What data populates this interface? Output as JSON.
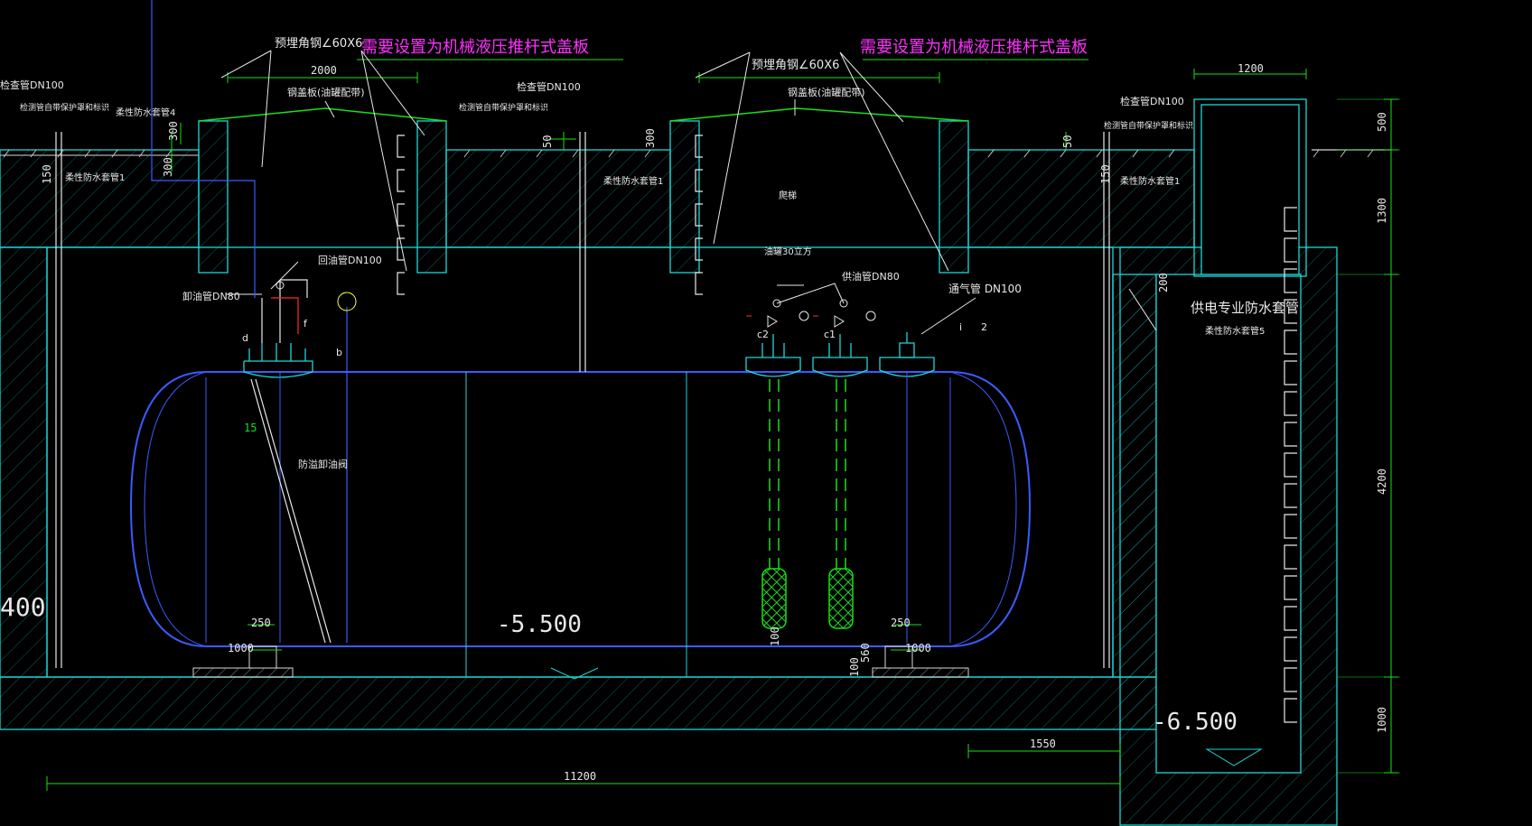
{
  "colors": {
    "background": "#000000",
    "structure": "#1fd6d6",
    "tank": "#3a5cff",
    "dimension": "#18e018",
    "text": "#e8e8e8",
    "heading": "#ff30ff",
    "pipe_red": "#ff2a2a",
    "level": "#ffff40",
    "ground": "#d8d8d8"
  },
  "notes": {
    "cover_left": "需要设置为机械液压推杆式盖板",
    "cover_right": "需要设置为机械液压推杆式盖板",
    "embedded_angle_left": "预埋角钢∠60X6",
    "embedded_angle_right": "预埋角钢∠60X6",
    "steel_cover_left": "钢盖板(油罐配带)",
    "steel_cover_right": "钢盖板(油罐配带)",
    "inspect_pipe_left_edge": "检查管DN100",
    "inspect_far_left": "检测管自带保护罩和标识",
    "flex_sleeve_4": "柔性防水套管4",
    "flex_sleeve_1_a": "柔性防水套管1",
    "inspect_pipe_mid": "检查管DN100",
    "inspect_note_mid": "检测管自带保护罩和标识",
    "flex_sleeve_1_b": "柔性防水套管1",
    "inspect_pipe_right": "检查管DN100",
    "inspect_note_right": "检测管自带保护罩和标识",
    "flex_sleeve_1_c": "柔性防水套管1",
    "return_oil_pipe": "回油管DN100",
    "unload_pipe": "卸油管DN80",
    "overflow_valve": "防溢卸油阀",
    "ladder": "爬梯",
    "tank_capacity": "油罐30立方",
    "oil_supply_pipe": "供油管DN80",
    "vent_pipe": "通气管 DN100",
    "power_sleeve": "供电专业防水套管",
    "flex_sleeve_5": "柔性防水套管5",
    "c2": "c2",
    "c1": "c1",
    "label_i": "i",
    "label_2": "2",
    "label_f": "f",
    "label_d": "d",
    "label_b": "b"
  },
  "dimensions": {
    "d2000": "2000",
    "d1200": "1200",
    "d500": "500",
    "d1300": "1300",
    "d4200": "4200",
    "d1000": "1000",
    "d1550": "1550",
    "d11200": "11200",
    "d300a": "300",
    "d300b": "300",
    "d300c": "300",
    "d50a": "50",
    "d50b": "50",
    "d150a": "150",
    "d150b": "150",
    "d200": "200",
    "d250a": "250",
    "d250b": "250",
    "d1000a": "1000",
    "d1000b": "1000",
    "d100a": "100",
    "d100b": "100",
    "d560": "560",
    "d15": "15",
    "d400": "400"
  },
  "levels": {
    "tank_bottom": "-5.500",
    "pit_bottom": "-6.500"
  }
}
